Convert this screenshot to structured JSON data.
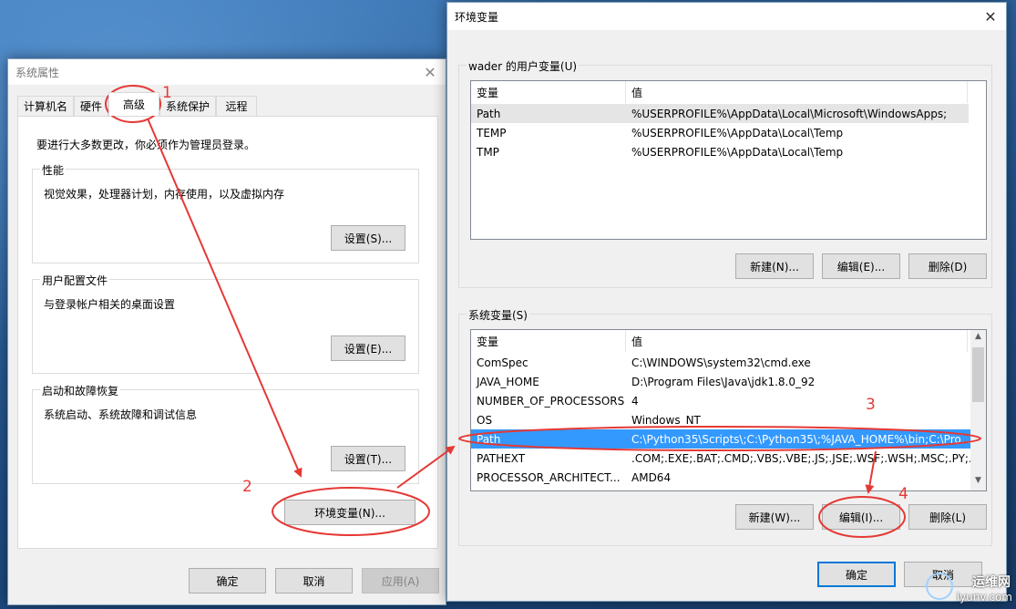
{
  "sys_props": {
    "title": "系统属性",
    "tabs": [
      {
        "label": "计算机名"
      },
      {
        "label": "硬件"
      },
      {
        "label": "高级"
      },
      {
        "label": "系统保护"
      },
      {
        "label": "远程"
      }
    ],
    "admin_notice": "要进行大多数更改，你必须作为管理员登录。",
    "performance": {
      "label": "性能",
      "desc": "视觉效果，处理器计划，内存使用，以及虚拟内存",
      "button": "设置(S)..."
    },
    "user_profiles": {
      "label": "用户配置文件",
      "desc": "与登录帐户相关的桌面设置",
      "button": "设置(E)..."
    },
    "startup": {
      "label": "启动和故障恢复",
      "desc": "系统启动、系统故障和调试信息",
      "button": "设置(T)..."
    },
    "env_button": "环境变量(N)...",
    "ok": "确定",
    "cancel": "取消",
    "apply": "应用(A)"
  },
  "env": {
    "title": "环境变量",
    "user_group_label": "wader 的用户变量(U)",
    "columns": {
      "var": "变量",
      "val": "值"
    },
    "user_vars": [
      {
        "name": "Path",
        "value": "%USERPROFILE%\\AppData\\Local\\Microsoft\\WindowsApps;"
      },
      {
        "name": "TEMP",
        "value": "%USERPROFILE%\\AppData\\Local\\Temp"
      },
      {
        "name": "TMP",
        "value": "%USERPROFILE%\\AppData\\Local\\Temp"
      }
    ],
    "user_buttons": {
      "new": "新建(N)...",
      "edit": "编辑(E)...",
      "delete": "删除(D)"
    },
    "sys_group_label": "系统变量(S)",
    "sys_vars": [
      {
        "name": "ComSpec",
        "value": "C:\\WINDOWS\\system32\\cmd.exe"
      },
      {
        "name": "JAVA_HOME",
        "value": "D:\\Program Files\\Java\\jdk1.8.0_92"
      },
      {
        "name": "NUMBER_OF_PROCESSORS",
        "value": "4"
      },
      {
        "name": "OS",
        "value": "Windows_NT"
      },
      {
        "name": "Path",
        "value": "C:\\Python35\\Scripts\\;C:\\Python35\\;%JAVA_HOME%\\bin;C:\\Pro..."
      },
      {
        "name": "PATHEXT",
        "value": ".COM;.EXE;.BAT;.CMD;.VBS;.VBE;.JS;.JSE;.WSF;.WSH;.MSC;.PY;.P..."
      },
      {
        "name": "PROCESSOR_ARCHITECT...",
        "value": "AMD64"
      }
    ],
    "sys_buttons": {
      "new": "新建(W)...",
      "edit": "编辑(I)...",
      "delete": "删除(L)"
    },
    "ok": "确定",
    "cancel": "取消"
  },
  "annotations": [
    "1",
    "2",
    "3",
    "4"
  ],
  "watermark": {
    "line1": "运维网",
    "line2": "iyunv.com"
  },
  "colors": {
    "annotation": "#e53935",
    "selection": "#3399ff",
    "accent": "#0078d7"
  }
}
